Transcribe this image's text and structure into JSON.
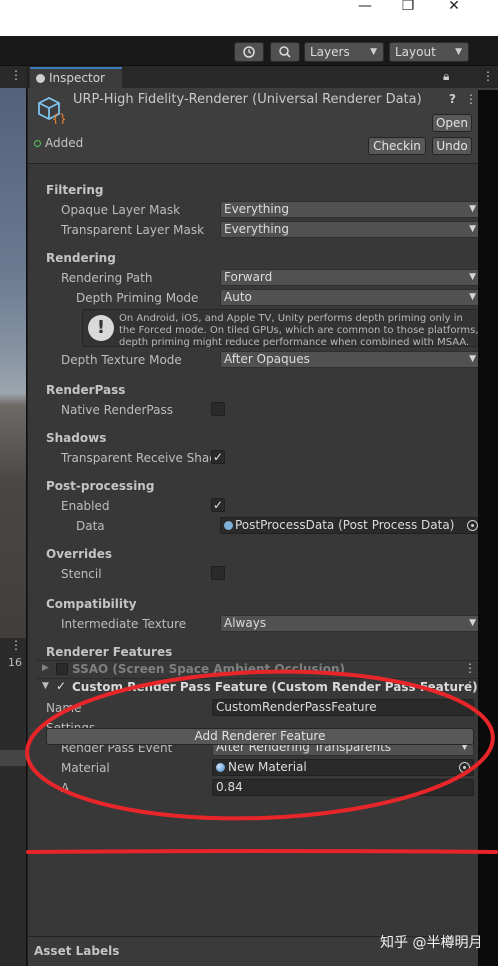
{
  "window": {
    "minimize": "—",
    "restore": "❐",
    "close": "✕"
  },
  "toolbar": {
    "history_icon": "history-icon",
    "search_icon": "search-icon",
    "layers_label": "Layers",
    "layout_label": "Layout"
  },
  "left_pane": {
    "count_label": "16"
  },
  "inspector": {
    "tab_label": "Inspector",
    "object_title": "URP-High Fidelity-Renderer (Universal Renderer Data)",
    "open_label": "Open",
    "added_label": "Added",
    "checkin_label": "Checkin",
    "undo_label": "Undo"
  },
  "sections": {
    "filtering": "Filtering",
    "rendering": "Rendering",
    "renderpass": "RenderPass",
    "shadows": "Shadows",
    "postprocessing": "Post-processing",
    "overrides": "Overrides",
    "compatibility": "Compatibility",
    "renderer_features": "Renderer Features"
  },
  "fields": {
    "opaque_layer_mask": {
      "label": "Opaque Layer Mask",
      "value": "Everything"
    },
    "transparent_layer_mask": {
      "label": "Transparent Layer Mask",
      "value": "Everything"
    },
    "rendering_path": {
      "label": "Rendering Path",
      "value": "Forward"
    },
    "depth_priming_mode": {
      "label": "Depth Priming Mode",
      "value": "Auto"
    },
    "help_text": "On Android, iOS, and Apple TV, Unity performs depth priming only in the Forced mode. On tiled GPUs, which are common to those platforms, depth priming might reduce performance when combined with MSAA.",
    "depth_texture_mode": {
      "label": "Depth Texture Mode",
      "value": "After Opaques"
    },
    "native_renderpass": {
      "label": "Native RenderPass",
      "checked": false
    },
    "transparent_receive_shadows": {
      "label": "Transparent Receive Shad",
      "checked": true
    },
    "pp_enabled": {
      "label": "Enabled",
      "checked": true
    },
    "pp_data": {
      "label": "Data",
      "value": "PostProcessData (Post Process Data)"
    },
    "stencil": {
      "label": "Stencil",
      "checked": false
    },
    "intermediate_texture": {
      "label": "Intermediate Texture",
      "value": "Always"
    }
  },
  "features": [
    {
      "name": "SSAO (Screen Space Ambient Occlusion)",
      "enabled": false
    },
    {
      "name": "Custom Render Pass Feature (Custom Render Pass Feature)",
      "enabled": true
    }
  ],
  "custom_feature": {
    "name_label": "Name",
    "name_value": "CustomRenderPassFeature",
    "settings_label": "Settings",
    "render_pass_event_label": "Render Pass Event",
    "render_pass_event_value": "After Rendering Transparents",
    "material_label": "Material",
    "material_value": "New Material",
    "a_label": "A",
    "a_value": "0.84"
  },
  "add_renderer_feature": "Add Renderer Feature",
  "asset_labels": "Asset Labels",
  "watermark": "知乎 @半樽明月",
  "annotation_color": "#e8262a"
}
